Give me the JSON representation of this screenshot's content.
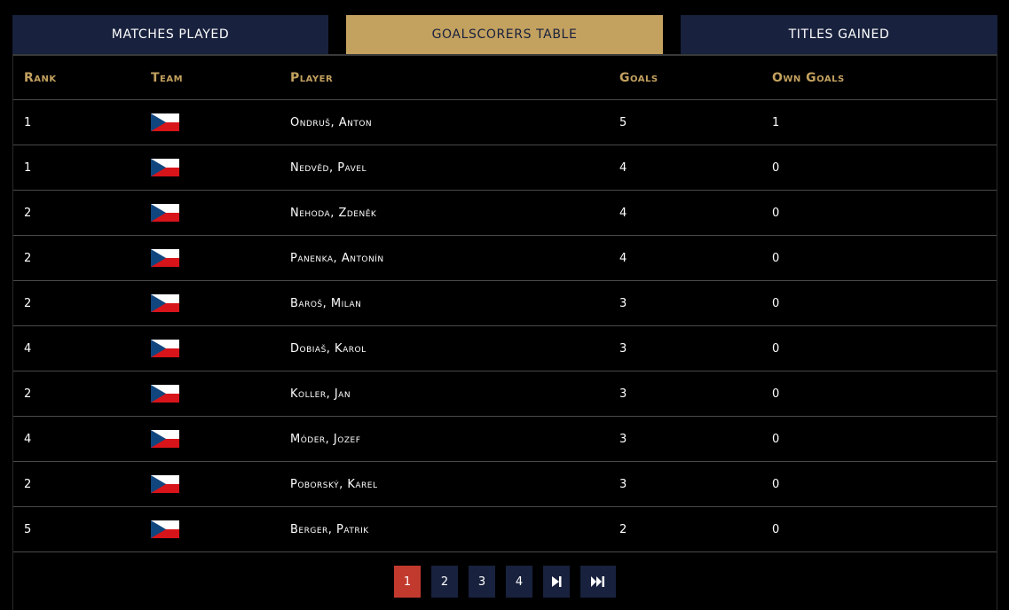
{
  "tabs": [
    {
      "label": "Matches Played"
    },
    {
      "label": "Goalscorers Table"
    },
    {
      "label": "Titles Gained"
    }
  ],
  "table": {
    "headers": {
      "rank": "Rank",
      "team": "Team",
      "player": "Player",
      "goals": "Goals",
      "own_goals": "Own Goals"
    },
    "rows": [
      {
        "rank": "1",
        "team_icon": "czech-flag-icon",
        "player": "Ondruš, Anton",
        "goals": "5",
        "own_goals": "1"
      },
      {
        "rank": "1",
        "team_icon": "czech-flag-icon",
        "player": "Nedvěd, Pavel",
        "goals": "4",
        "own_goals": "0"
      },
      {
        "rank": "2",
        "team_icon": "czech-flag-icon",
        "player": "Nehoda, Zdeněk",
        "goals": "4",
        "own_goals": "0"
      },
      {
        "rank": "2",
        "team_icon": "czech-flag-icon",
        "player": "Panenka, Antonín",
        "goals": "4",
        "own_goals": "0"
      },
      {
        "rank": "2",
        "team_icon": "czech-flag-icon",
        "player": "Baroš, Milan",
        "goals": "3",
        "own_goals": "0"
      },
      {
        "rank": "4",
        "team_icon": "czech-flag-icon",
        "player": "Dobiaš, Karol",
        "goals": "3",
        "own_goals": "0"
      },
      {
        "rank": "2",
        "team_icon": "czech-flag-icon",
        "player": "Koller, Jan",
        "goals": "3",
        "own_goals": "0"
      },
      {
        "rank": "4",
        "team_icon": "czech-flag-icon",
        "player": "Móder, Jozef",
        "goals": "3",
        "own_goals": "0"
      },
      {
        "rank": "2",
        "team_icon": "czech-flag-icon",
        "player": "Poborský, Karel",
        "goals": "3",
        "own_goals": "0"
      },
      {
        "rank": "5",
        "team_icon": "czech-flag-icon",
        "player": "Berger, Patrik",
        "goals": "2",
        "own_goals": "0"
      }
    ]
  },
  "pagination": {
    "pages": [
      "1",
      "2",
      "3",
      "4"
    ],
    "current": "1",
    "next_icon": "next-page-icon",
    "last_icon": "last-page-icon"
  },
  "colors": {
    "accent_gold": "#c3a15f",
    "navy": "#18213d",
    "active_page_red": "#c23a2e",
    "flag_red": "#d7141a",
    "flag_blue": "#11457e"
  }
}
